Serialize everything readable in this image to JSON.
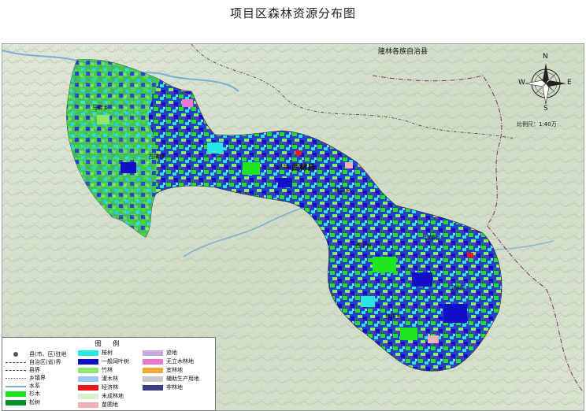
{
  "title": "项目区森林资源分布图",
  "places": {
    "autonomous_county": "隆林各族自治县",
    "county_seat": "西林县",
    "townships": [
      "马蚌乡",
      "古障镇",
      "八达镇",
      "普合乡",
      "西平乡",
      "那劳乡",
      "足别乡",
      "那佐乡"
    ]
  },
  "compass": {
    "n": "N",
    "s": "S",
    "w": "W",
    "e": "E"
  },
  "scale": "比例尺：1:40万",
  "legend": {
    "title": "图 例",
    "col1": [
      {
        "label": "县(市、区)驻地",
        "kind": "dot"
      },
      {
        "label": "自治区(省)界",
        "kind": "line",
        "color": "#8b2a6a"
      },
      {
        "label": "县界",
        "kind": "line",
        "color": "#444444"
      },
      {
        "label": "乡镇界",
        "kind": "line",
        "color": "#666666"
      },
      {
        "label": "水系",
        "kind": "line",
        "color": "#7ab0d8"
      },
      {
        "label": "杉木",
        "kind": "fill",
        "color": "#1ee61e"
      },
      {
        "label": "松树",
        "kind": "fill",
        "color": "#0a8f2e"
      }
    ],
    "col2": [
      {
        "label": "桉树",
        "color": "#28e6e6"
      },
      {
        "label": "一般阔叶树",
        "color": "#1010c8"
      },
      {
        "label": "竹林",
        "color": "#8ee870"
      },
      {
        "label": "灌木林",
        "color": "#9cc8f0"
      },
      {
        "label": "经济林",
        "color": "#e81818"
      },
      {
        "label": "未成林地",
        "color": "#d8f0c8"
      },
      {
        "label": "苗圃地",
        "color": "#f0b0b8"
      }
    ],
    "col3": [
      {
        "label": "迹地",
        "color": "#c8a8e0"
      },
      {
        "label": "无立木林地",
        "color": "#e878d0"
      },
      {
        "label": "宜林地",
        "color": "#f0a838"
      },
      {
        "label": "辅助生产用地",
        "color": "#c8c8c8"
      },
      {
        "label": "非林地",
        "color": "#3c3c84"
      }
    ]
  }
}
